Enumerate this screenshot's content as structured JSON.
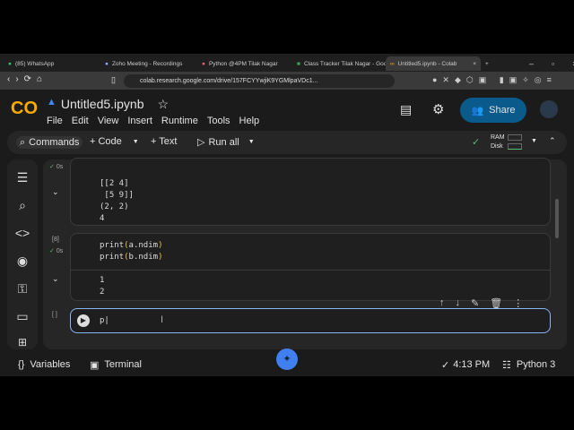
{
  "browser": {
    "tabs": [
      "(85) WhatsApp",
      "Zoho Meeting - Recordings",
      "Python @4PM Tilak Nagar",
      "Class Tracker Tilak Nagar - Goo",
      "Untitled5.ipynb - Colab"
    ],
    "url": "colab.research.google.com/drive/157FCYYwjiK9YGMlpaVDc1..."
  },
  "notebook": {
    "title": "Untitled5.ipynb",
    "menu": [
      "File",
      "Edit",
      "View",
      "Insert",
      "Runtime",
      "Tools",
      "Help"
    ],
    "share": "Share"
  },
  "toolbar": {
    "commands": "Commands",
    "code": "+ Code",
    "text": "+ Text",
    "run_all": "Run all",
    "ram": "RAM",
    "disk": "Disk"
  },
  "cells": [
    {
      "status": "0s",
      "output": [
        "[[2 4]",
        " [5 9]]",
        "(2, 2)",
        "4"
      ]
    },
    {
      "exec": "[8]",
      "status": "0s",
      "code": [
        "print(a.ndim)",
        "print(b.ndim)"
      ],
      "output": [
        "1",
        "2"
      ]
    },
    {
      "exec": "[ ]",
      "code": "p"
    }
  ],
  "status": {
    "variables": "Variables",
    "terminal": "Terminal",
    "time": "4:13 PM",
    "runtime": "Python 3"
  }
}
